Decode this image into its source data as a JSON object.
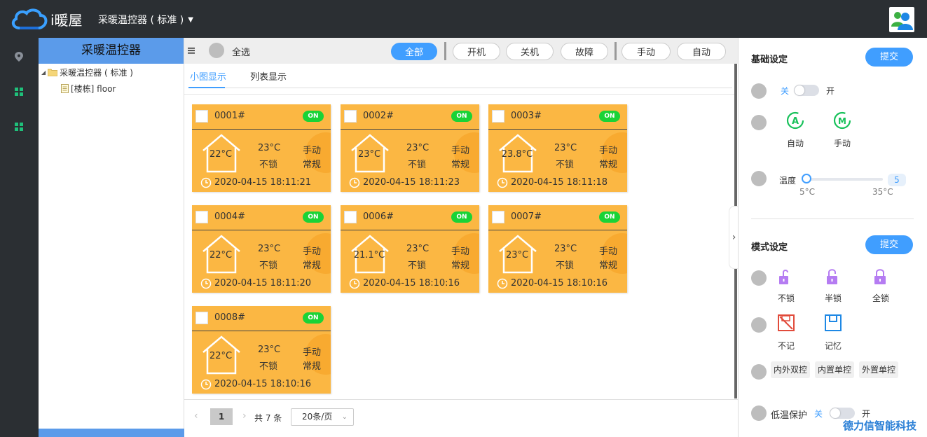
{
  "app": {
    "logo_text": "i暖屋",
    "device_selector": "采暖温控器 ( 标准 )"
  },
  "tree": {
    "header": "采暖温控器",
    "root_label": "采暖温控器 ( 标准 )",
    "child_label": "[楼栋] floor"
  },
  "toolbar": {
    "select_all": "全选",
    "filters": [
      "全部",
      "开机",
      "关机",
      "故障",
      "手动",
      "自动"
    ],
    "active_filter": "全部"
  },
  "view_tabs": {
    "small": "小图显示",
    "list": "列表显示",
    "active": "小图显示"
  },
  "cards": [
    {
      "id": "0001#",
      "status": "ON",
      "temp": "22°C",
      "set_temp": "23°C",
      "mode": "手动",
      "lock": "不锁",
      "type": "常规",
      "time": "2020-04-15 18:11:21"
    },
    {
      "id": "0002#",
      "status": "ON",
      "temp": "23°C",
      "set_temp": "23°C",
      "mode": "手动",
      "lock": "不锁",
      "type": "常规",
      "time": "2020-04-15 18:11:23"
    },
    {
      "id": "0003#",
      "status": "ON",
      "temp": "23.8°C",
      "set_temp": "23°C",
      "mode": "手动",
      "lock": "不锁",
      "type": "常规",
      "time": "2020-04-15 18:11:18"
    },
    {
      "id": "0004#",
      "status": "ON",
      "temp": "22°C",
      "set_temp": "23°C",
      "mode": "手动",
      "lock": "不锁",
      "type": "常规",
      "time": "2020-04-15 18:11:20"
    },
    {
      "id": "0006#",
      "status": "ON",
      "temp": "21.1°C",
      "set_temp": "23°C",
      "mode": "手动",
      "lock": "不锁",
      "type": "常规",
      "time": "2020-04-15 18:10:16"
    },
    {
      "id": "0007#",
      "status": "ON",
      "temp": "23°C",
      "set_temp": "23°C",
      "mode": "手动",
      "lock": "不锁",
      "type": "常规",
      "time": "2020-04-15 18:10:16"
    },
    {
      "id": "0008#",
      "status": "ON",
      "temp": "22°C",
      "set_temp": "23°C",
      "mode": "手动",
      "lock": "不锁",
      "type": "常规",
      "time": "2020-04-15 18:10:16"
    }
  ],
  "pager": {
    "current_page": "1",
    "total": "共 7 条",
    "page_size": "20条/页"
  },
  "basic": {
    "title": "基础设定",
    "submit": "提交",
    "power_off": "关",
    "power_on": "开",
    "mode_auto": "自动",
    "mode_manual": "手动",
    "temp_label": "温度",
    "temp_value": "5",
    "temp_min": "5°C",
    "temp_max": "35°C",
    "temp_fraction": 0
  },
  "mode": {
    "title": "模式设定",
    "submit": "提交",
    "lock_options": [
      "不锁",
      "半锁",
      "全锁"
    ],
    "memory_options": [
      "不记",
      "记忆"
    ],
    "control_options": [
      "内外双控",
      "内置单控",
      "外置单控"
    ],
    "low_temp_label": "低温保护",
    "low_temp_off": "关",
    "low_temp_on": "开"
  },
  "watermark": "德力信智能科技",
  "colors": {
    "card": "#fbb743",
    "accent": "#409eff",
    "on_badge": "#1ad336",
    "nav": "#2b2f33",
    "tree_header": "#5b9bea"
  }
}
